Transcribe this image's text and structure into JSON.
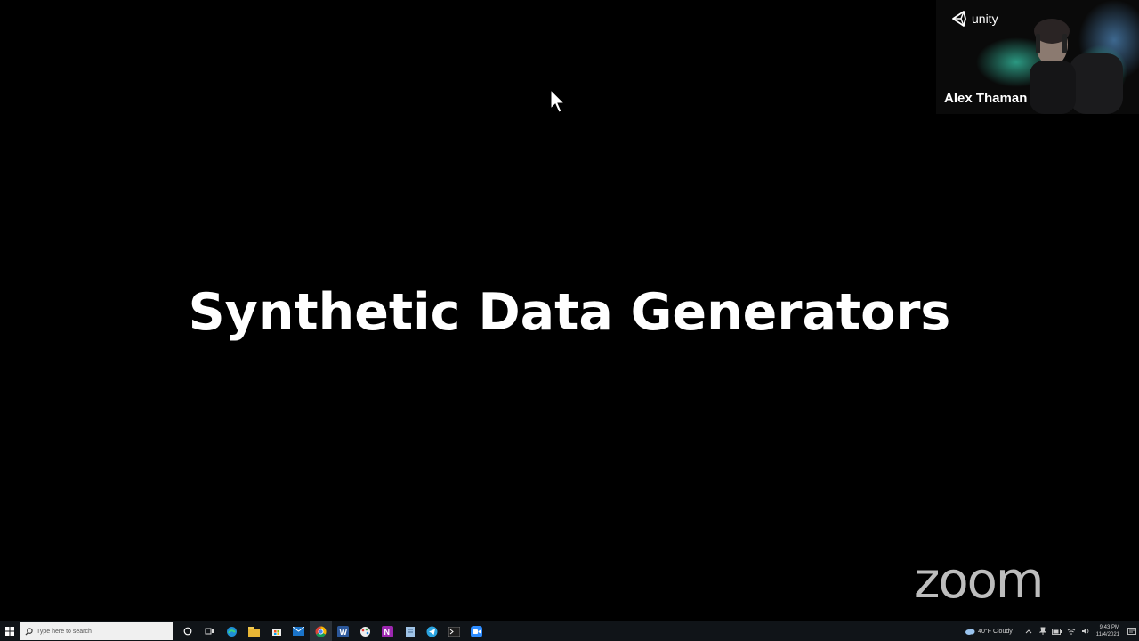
{
  "slide": {
    "title": "Synthetic Data Generators"
  },
  "video_tile": {
    "brand": "unity",
    "participant_name": "Alex Thaman"
  },
  "watermark": {
    "text": "zoom"
  },
  "taskbar": {
    "search_placeholder": "Type here to search",
    "apps": [
      {
        "name": "cortana-icon"
      },
      {
        "name": "task-view-icon"
      },
      {
        "name": "edge-icon"
      },
      {
        "name": "file-explorer-icon"
      },
      {
        "name": "store-icon"
      },
      {
        "name": "mail-icon"
      },
      {
        "name": "chrome-icon"
      },
      {
        "name": "word-icon"
      },
      {
        "name": "paint-icon"
      },
      {
        "name": "onenote-icon"
      },
      {
        "name": "notepad-icon"
      },
      {
        "name": "telegram-icon"
      },
      {
        "name": "terminal-icon"
      },
      {
        "name": "zoom-icon"
      }
    ],
    "weather": "40°F Cloudy",
    "clock_time": "9:43 PM",
    "clock_date": "11/4/2021"
  },
  "colors": {
    "slide_bg": "#000000",
    "title": "#ffffff",
    "taskbar_bg": "#101418",
    "zoom_watermark": "#bdbdbd"
  }
}
